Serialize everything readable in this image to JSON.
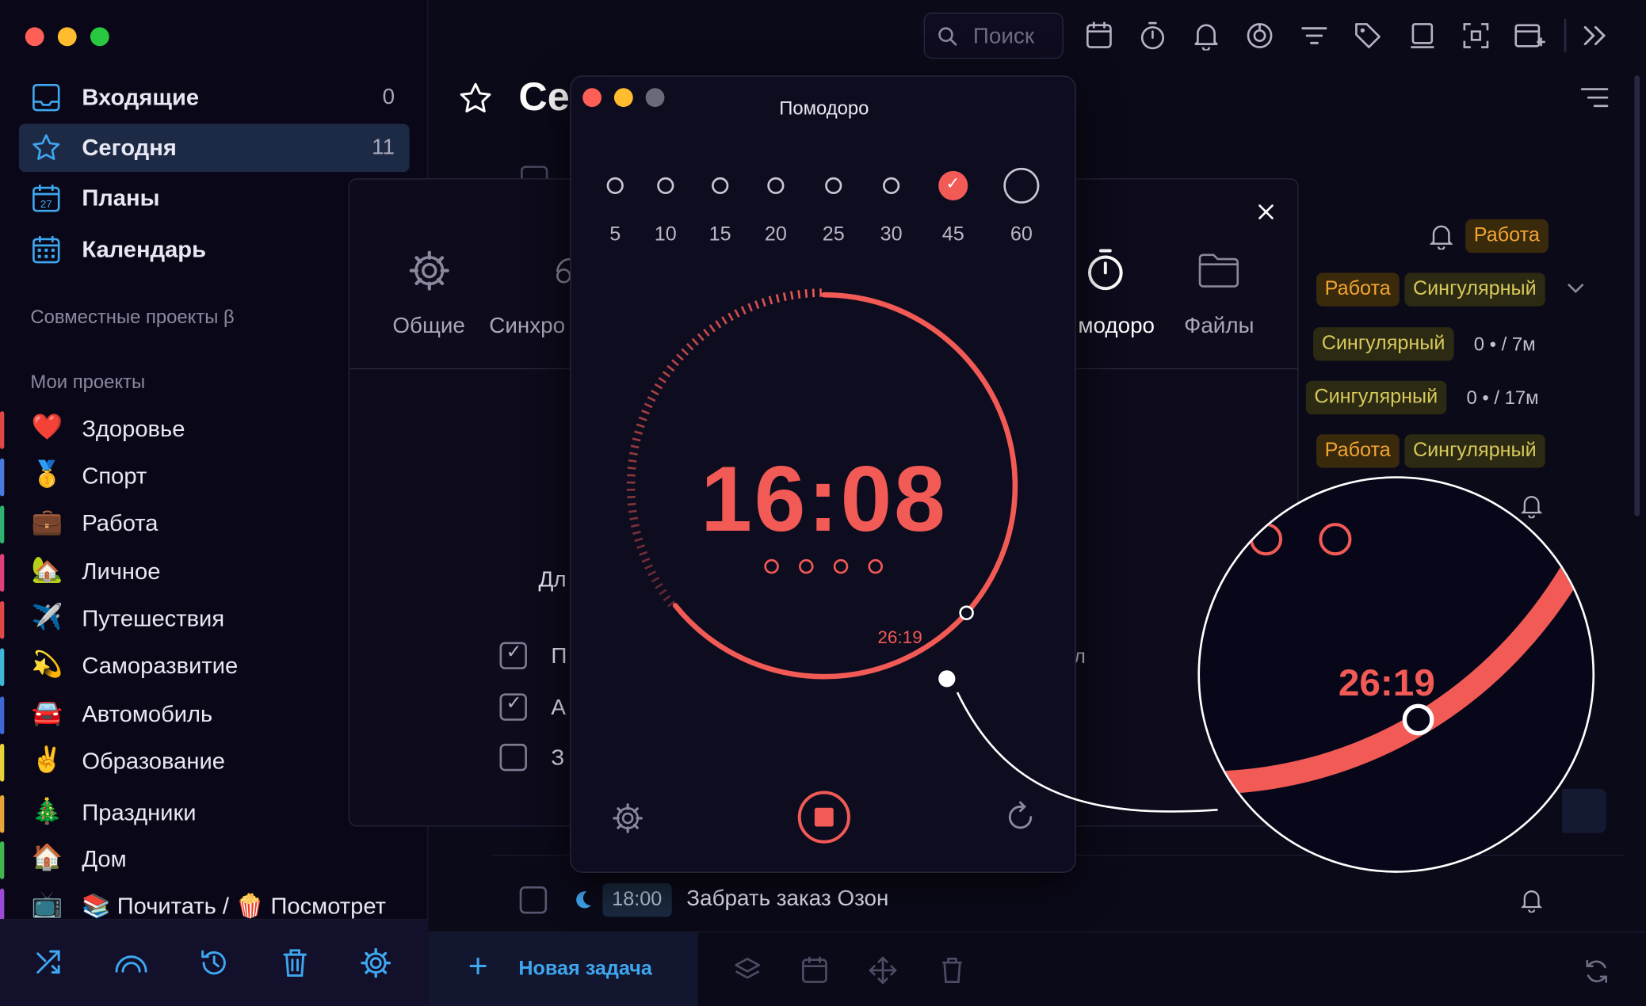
{
  "sidebar": {
    "nav": [
      {
        "label": "Входящие",
        "count": "0"
      },
      {
        "label": "Сегодня",
        "count": "11"
      },
      {
        "label": "Планы",
        "count": ""
      },
      {
        "label": "Календарь",
        "count": ""
      }
    ],
    "calendar_day": "27",
    "shared_section": "Совместные проекты β",
    "my_section": "Мои проекты",
    "projects": [
      {
        "emoji": "❤️",
        "label": "Здоровье",
        "color": "#e04848"
      },
      {
        "emoji": "🥇",
        "label": "Спорт",
        "color": "#4a7ce0"
      },
      {
        "emoji": "💼",
        "label": "Работа",
        "color": "#2fb36e"
      },
      {
        "emoji": "🏡",
        "label": "Личное",
        "color": "#e0407a"
      },
      {
        "emoji": "✈️",
        "label": "Путешествия",
        "color": "#e04848"
      },
      {
        "emoji": "💫",
        "label": "Саморазвитие",
        "color": "#3fb7d6"
      },
      {
        "emoji": "🚘",
        "label": "Автомобиль",
        "color": "#3f68d6"
      },
      {
        "emoji": "✌️",
        "label": "Образование",
        "color": "#e8d23a"
      },
      {
        "emoji": "🎄",
        "label": "Праздники",
        "color": "#e8a33a"
      },
      {
        "emoji": "🏠",
        "label": "Дом",
        "color": "#3fb74e"
      },
      {
        "emoji": "📺",
        "label": "📚 Почитать / 🍿 Посмотреть",
        "color": "#9a4ad6"
      }
    ]
  },
  "header": {
    "title": "Сегодня",
    "title_visible": "Се",
    "search_placeholder": "Поиск"
  },
  "settings_tabs": [
    "Общие",
    "Синхро",
    "модоро",
    "Файлы"
  ],
  "settings_partial": {
    "label": "Дл",
    "check1": "П",
    "check2": "А",
    "check3": "З",
    "right_fragment": "л"
  },
  "tags": {
    "work": "Работа",
    "singular": "Сингулярный",
    "colors": {
      "work_bg": "#3a2a0c",
      "work_fg": "#f3a531",
      "singular_bg": "#2c2a12",
      "singular_fg": "#d7c85a"
    }
  },
  "task_meta": [
    "0 • / 7м",
    "0 • / 17м"
  ],
  "task_bottom": {
    "time": "18:00",
    "title": "Забрать заказ Озон"
  },
  "new_task": "Новая задача",
  "pomodoro": {
    "title": "Помодоро",
    "durations": [
      "5",
      "10",
      "15",
      "20",
      "25",
      "30",
      "45",
      "60"
    ],
    "selected": "45",
    "time": "16:08",
    "elapsed_marker": "26:19",
    "progress_fraction": 0.642,
    "rounds": 4,
    "accent": "#f25a55"
  },
  "zoom_label": "26:19"
}
